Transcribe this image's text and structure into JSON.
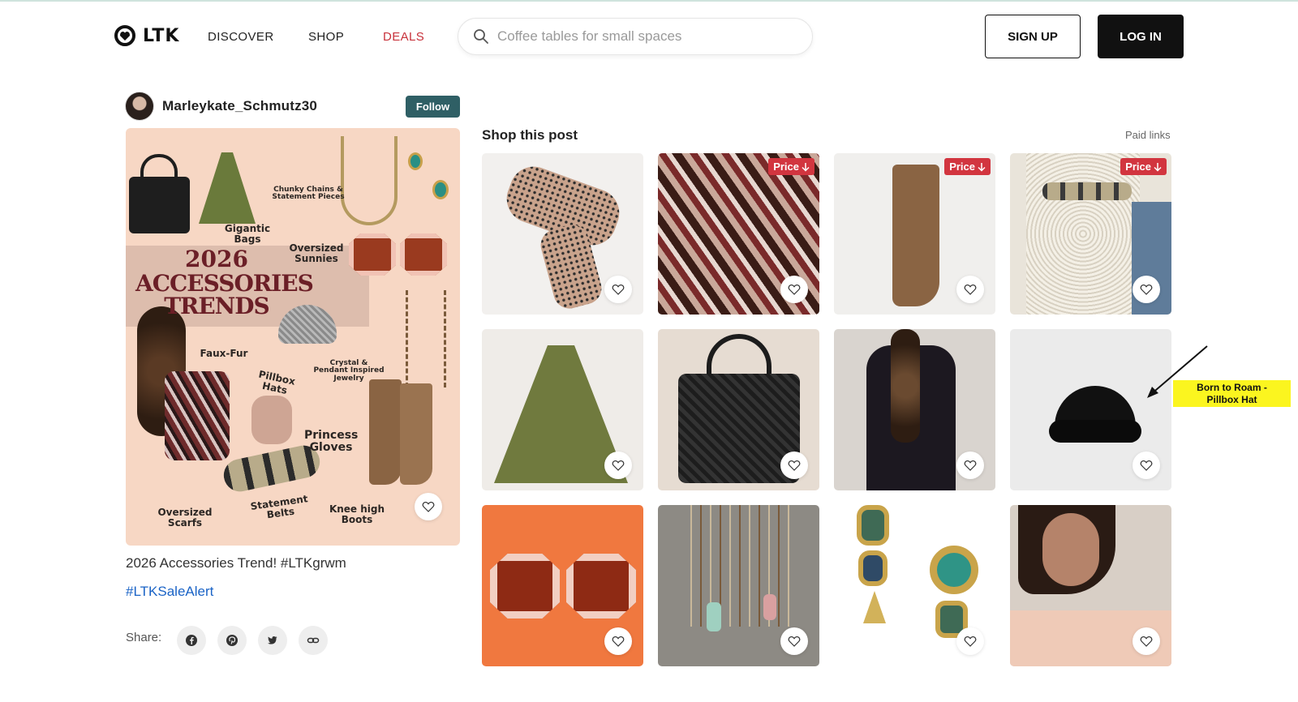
{
  "header": {
    "logo_text": "LTK",
    "nav": {
      "discover": "DISCOVER",
      "shop": "SHOP",
      "deals": "DEALS"
    },
    "search_placeholder": "Coffee tables for small spaces",
    "signup_label": "SIGN UP",
    "login_label": "LOG IN"
  },
  "creator": {
    "name": "Marleykate_Schmutz30",
    "follow_label": "Follow"
  },
  "post": {
    "art": {
      "year": "2026",
      "title_line1": "ACCESSORIES",
      "title_line2": "TRENDS",
      "labels": {
        "chunky": "Chunky Chains & Statement Pieces",
        "bags": "Gigantic Bags",
        "sunnies": "Oversized Sunnies",
        "fauxfur": "Faux-Fur",
        "pillbox": "Pillbox Hats",
        "crystal": "Crystal & Pendant Inspired Jewelry",
        "gloves": "Princess Gloves",
        "scarfs": "Oversized Scarfs",
        "belts": "Statement Belts",
        "boots": "Knee high Boots"
      }
    },
    "caption": "2026 Accessories Trend! #LTKgrwm",
    "hashtag": "#LTKSaleAlert",
    "share_label": "Share:"
  },
  "shop": {
    "title": "Shop this post",
    "paid_links": "Paid links",
    "price_badge": "Price",
    "products": [
      {
        "name": "lace-gloves",
        "badge": false
      },
      {
        "name": "printed-scarf",
        "badge": true
      },
      {
        "name": "suede-boots",
        "badge": true
      },
      {
        "name": "statement-belt",
        "badge": true
      },
      {
        "name": "suede-hobo-bag",
        "badge": false
      },
      {
        "name": "woven-tote",
        "badge": false
      },
      {
        "name": "faux-fur-scarf",
        "badge": false
      },
      {
        "name": "pillbox-hat",
        "badge": false
      },
      {
        "name": "oversized-sunglasses",
        "badge": false
      },
      {
        "name": "pendant-necklaces",
        "badge": false
      },
      {
        "name": "statement-earrings",
        "badge": false
      },
      {
        "name": "model-necklace",
        "badge": false
      }
    ]
  },
  "annotation": {
    "line1": "Born to Roam -",
    "line2": "Pillbox Hat"
  },
  "colors": {
    "deals": "#c8323b",
    "follow": "#2f5f65",
    "price_badge": "#d2353f",
    "hashtag": "#1a63c6",
    "annotation": "#fbf51f"
  },
  "icons": [
    "ltk-logo-icon",
    "search-icon",
    "heart-icon",
    "facebook-icon",
    "pinterest-icon",
    "twitter-icon",
    "link-icon",
    "arrow-down-icon"
  ]
}
